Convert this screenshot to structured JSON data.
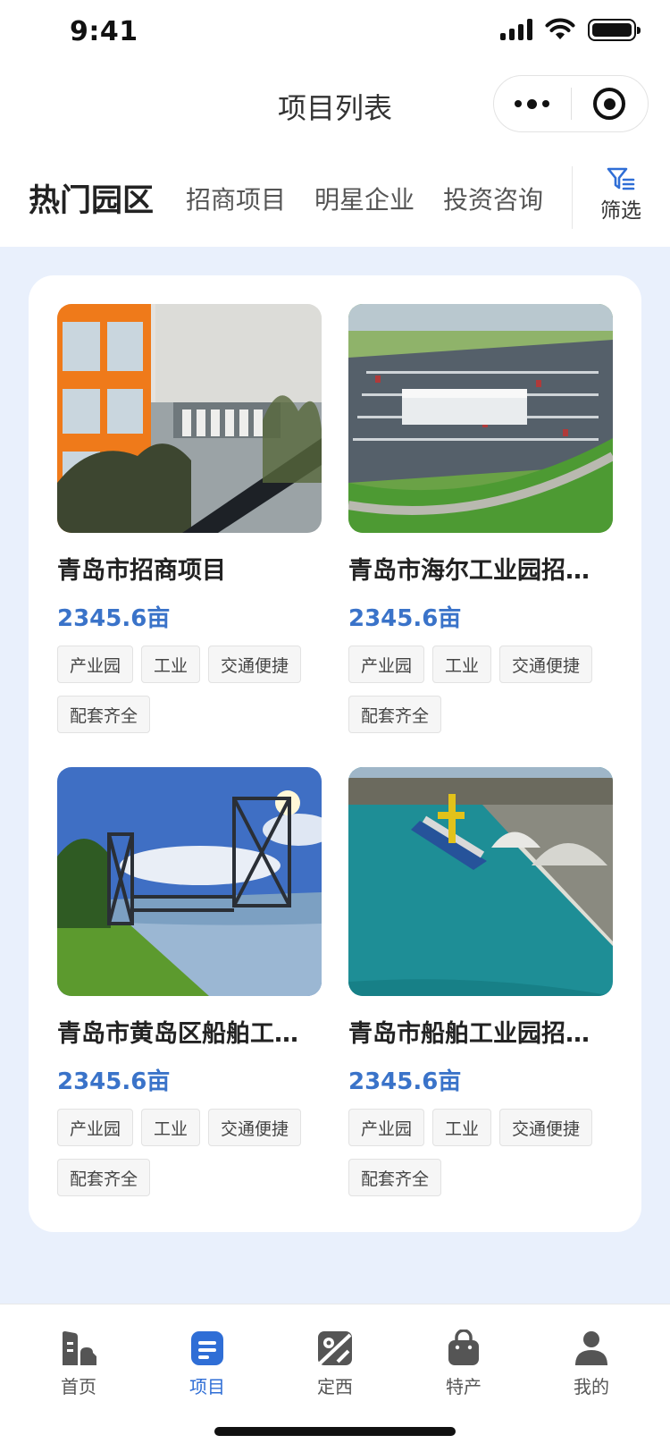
{
  "status": {
    "time": "9:41"
  },
  "nav": {
    "title": "项目列表"
  },
  "tabs": [
    {
      "label": "热门园区",
      "active": true
    },
    {
      "label": "招商项目",
      "active": false
    },
    {
      "label": "明星企业",
      "active": false
    },
    {
      "label": "投资咨询",
      "active": false
    }
  ],
  "filter": {
    "label": "筛选",
    "icon": "filter-icon"
  },
  "items": [
    {
      "title": "青岛市招商项目",
      "area": "2345.6亩",
      "tags": [
        "产业园",
        "工业",
        "交通便捷",
        "配套齐全"
      ],
      "image": "orange-building-photo"
    },
    {
      "title": "青岛市海尔工业园招…",
      "area": "2345.6亩",
      "tags": [
        "产业园",
        "工业",
        "交通便捷",
        "配套齐全"
      ],
      "image": "aerial-parking-lot-photo"
    },
    {
      "title": "青岛市黄岛区船舶工…",
      "area": "2345.6亩",
      "tags": [
        "产业园",
        "工业",
        "交通便捷",
        "配套齐全"
      ],
      "image": "lift-bridge-photo"
    },
    {
      "title": "青岛市船舶工业园招…",
      "area": "2345.6亩",
      "tags": [
        "产业园",
        "工业",
        "交通便捷",
        "配套齐全"
      ],
      "image": "harbor-ship-photo"
    }
  ],
  "tabbar": [
    {
      "label": "首页",
      "icon": "building-icon",
      "active": false
    },
    {
      "label": "项目",
      "icon": "list-icon",
      "active": true
    },
    {
      "label": "定西",
      "icon": "map-icon",
      "active": false
    },
    {
      "label": "特产",
      "icon": "bag-icon",
      "active": false
    },
    {
      "label": "我的",
      "icon": "user-icon",
      "active": false
    }
  ],
  "colors": {
    "accent": "#2f6ed6",
    "price": "#3a73c9",
    "background": "#e9f0fc"
  }
}
